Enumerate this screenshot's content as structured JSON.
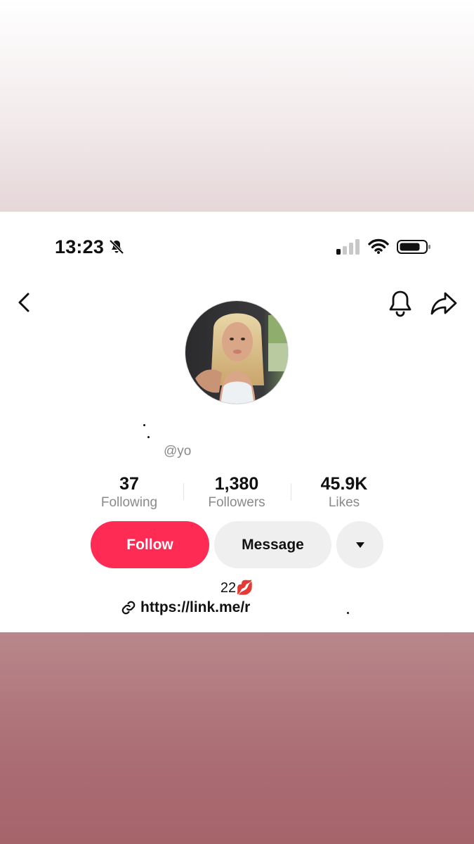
{
  "status_bar": {
    "time": "13:23"
  },
  "profile": {
    "handle": "@yo",
    "stats": [
      {
        "value": "37",
        "label": "Following"
      },
      {
        "value": "1,380",
        "label": "Followers"
      },
      {
        "value": "45.9K",
        "label": "Likes"
      }
    ],
    "bio": "22",
    "bio_emoji": "💋",
    "link": "https://link.me/r"
  },
  "actions": {
    "follow": "Follow",
    "message": "Message"
  },
  "colors": {
    "follow": "#fe2c55",
    "secondary_button": "#efefef",
    "muted_text": "#8a8a8a"
  },
  "icons": [
    "bell-off-icon",
    "signal-icon",
    "wifi-icon",
    "battery-icon",
    "back-arrow-icon",
    "bell-icon",
    "share-icon",
    "chevron-down-icon",
    "link-icon"
  ]
}
